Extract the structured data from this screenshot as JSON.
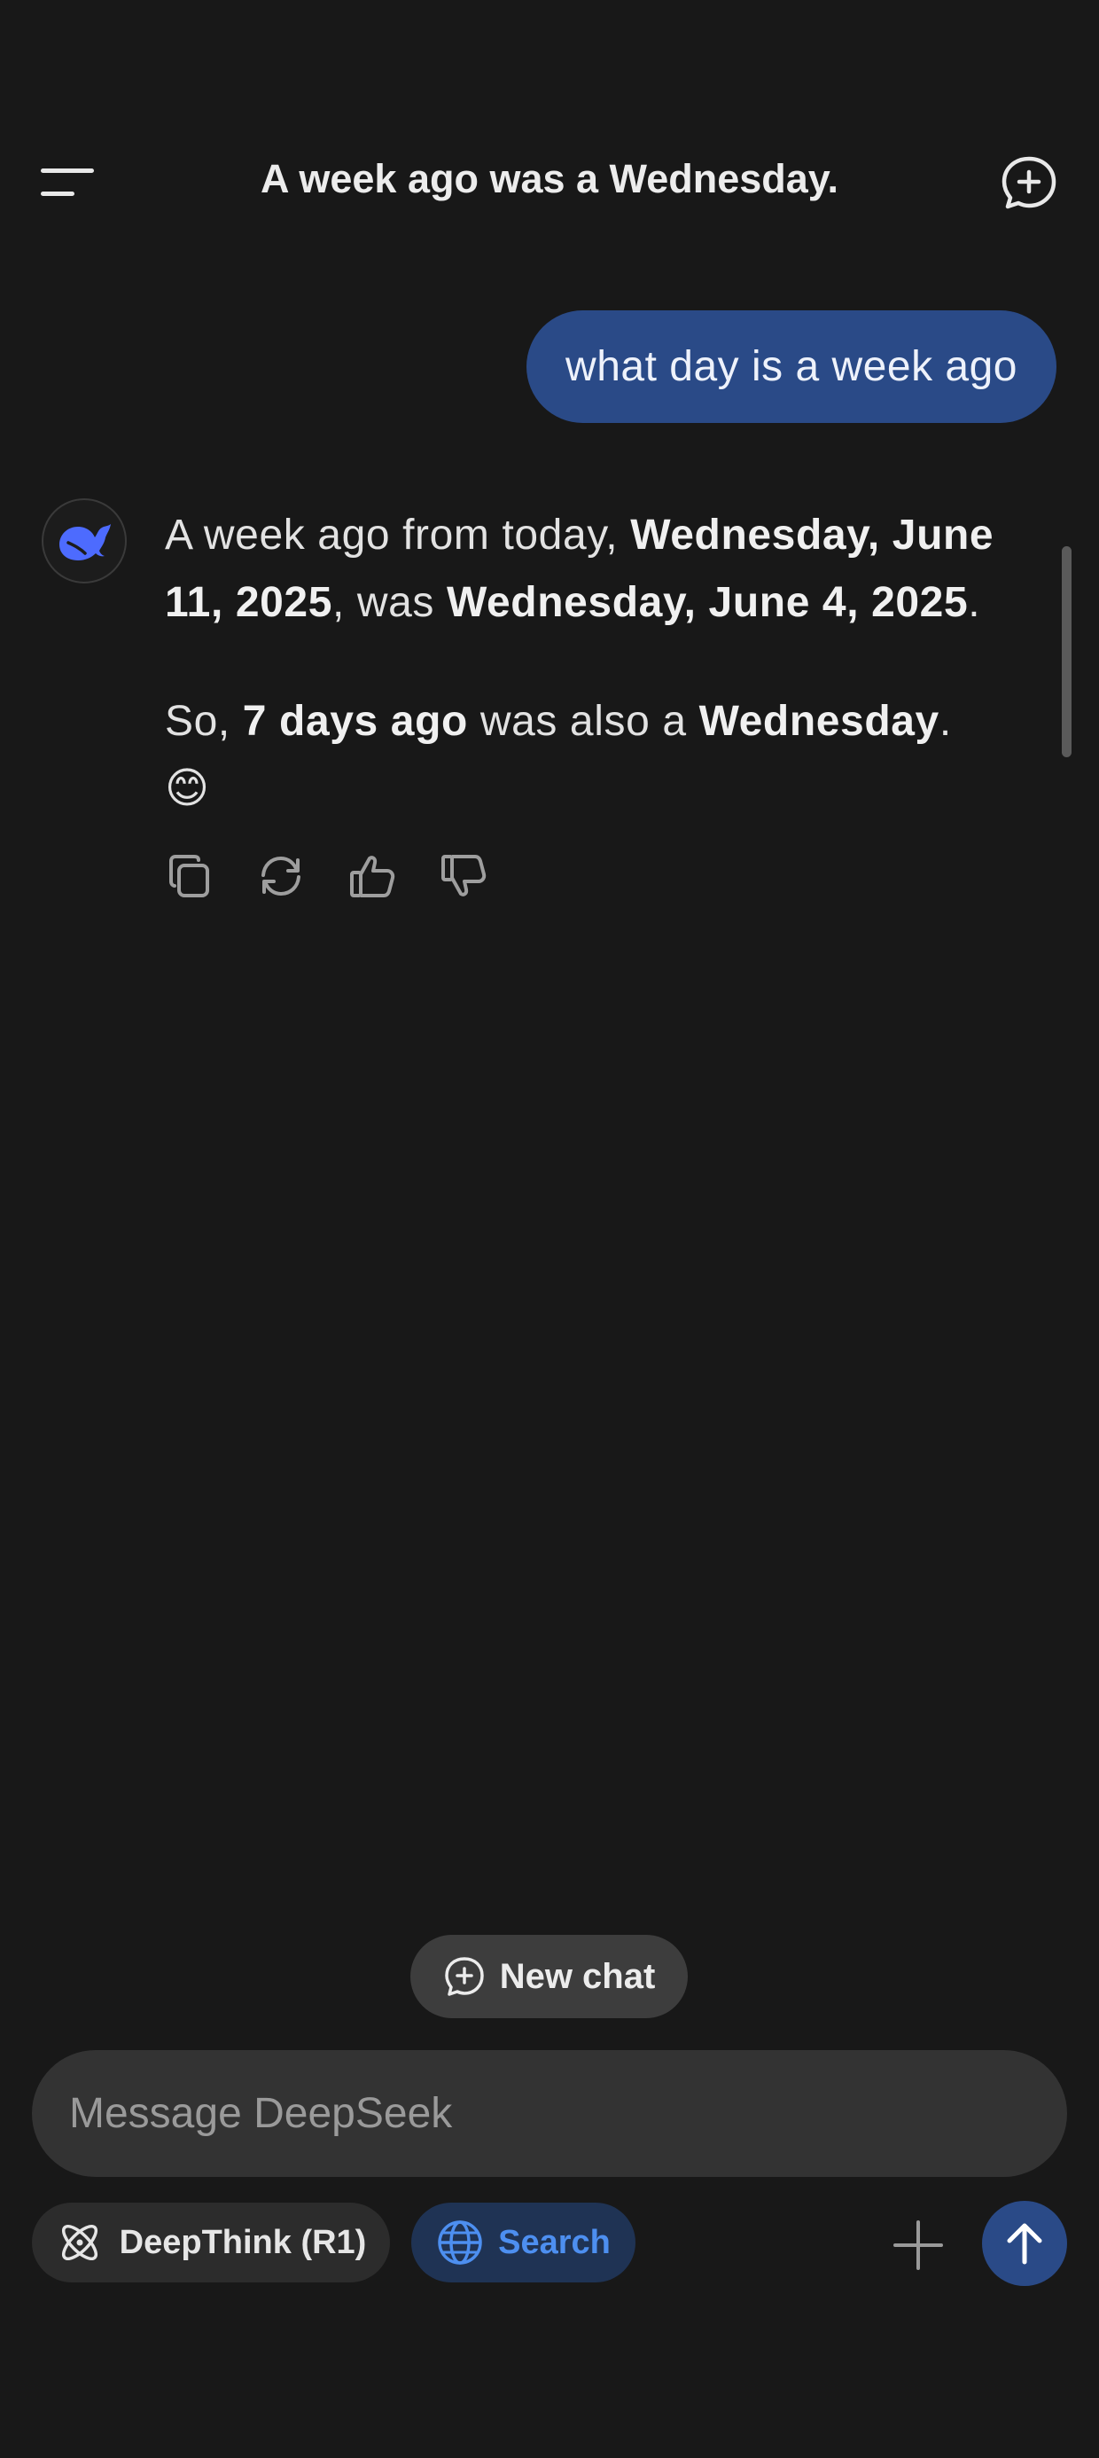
{
  "header": {
    "title": "A week ago was a Wednesday."
  },
  "conversation": {
    "user_message": "what day is a week ago",
    "reply": {
      "p1_a": "A week ago from today, ",
      "p1_b": "Wednesday, June 11, 2025",
      "p1_c": ", was ",
      "p1_d": "Wednesday, June 4, 2025",
      "p1_e": ".",
      "p2_a": "So, ",
      "p2_b": "7 days ago",
      "p2_c": " was also a ",
      "p2_d": "Wednesday",
      "p2_e": ".",
      "emoji": "😊"
    },
    "actions": [
      "copy-icon",
      "regenerate-icon",
      "thumbs-up-icon",
      "thumbs-down-icon"
    ]
  },
  "composer": {
    "new_chat_label": "New chat",
    "placeholder": "Message DeepSeek",
    "deepthink_label": "DeepThink (R1)",
    "search_label": "Search"
  },
  "colors": {
    "background": "#181818",
    "user_bubble": "#2a4a87",
    "accent_blue": "#4d8ff0",
    "logo_blue": "#4d6bfe"
  }
}
